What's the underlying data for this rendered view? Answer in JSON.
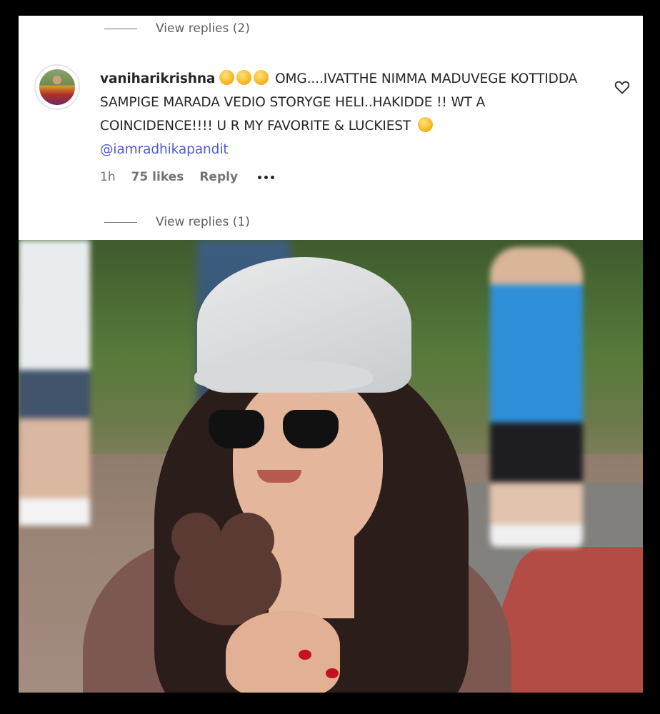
{
  "top_thread": {
    "view_replies_label": "View replies (2)"
  },
  "comment": {
    "username": "vaniharikrishna",
    "emojis": [
      "smiling-face-emoji",
      "kissing-face-emoji",
      "smiling-face-emoji"
    ],
    "text": "OMG....IVATTHE NIMMA MADUVEGE KOTTIDDA SAMPIGE MARADA VEDIO STORYGE HELI..HAKIDDE !! WT A COINCIDENCE!!!! U R MY FAVORITE & LUCKIEST",
    "end_emoji": "heart-eyes-emoji",
    "mention": "@iamradhikapandit",
    "time": "1h",
    "likes": "75 likes",
    "reply_label": "Reply"
  },
  "bottom_thread": {
    "view_replies_label": "View replies (1)"
  },
  "photo": {
    "description_icon": "photo-of-woman-with-mickey-icecream"
  }
}
